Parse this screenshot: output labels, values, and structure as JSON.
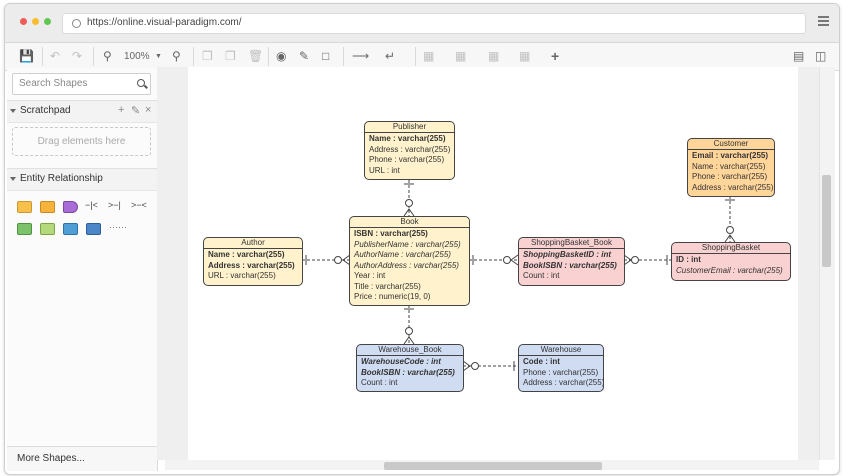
{
  "browser": {
    "url": "https://online.visual-paradigm.com/"
  },
  "toolbar": {
    "zoom": "100%"
  },
  "sidebar": {
    "search_placeholder": "Search Shapes",
    "scratchpad_title": "Scratchpad",
    "scratchpad_drag_text": "Drag elements here",
    "entity_section_title": "Entity Relationship",
    "more_shapes_label": "More Shapes..."
  },
  "diagram": {
    "publisher": {
      "title": "Publisher",
      "rows": [
        "Name : varchar(255)",
        "Address : varchar(255)",
        "Phone : varchar(255)",
        "URL : int"
      ]
    },
    "book": {
      "title": "Book",
      "rows": [
        "ISBN : varchar(255)",
        "PublisherName : varchar(255)",
        "AuthorName : varchar(255)",
        "AuthorAddress : varchar(255)",
        "Year : int",
        "Title : varchar(255)",
        "Price : numeric(19, 0)"
      ]
    },
    "author": {
      "title": "Author",
      "rows": [
        "Name : varchar(255)",
        "Address : varchar(255)",
        "URL : varchar(255)"
      ]
    },
    "customer": {
      "title": "Customer",
      "rows": [
        "Email : varchar(255)",
        "Name : varchar(255)",
        "Phone : varchar(255)",
        "Address : varchar(255)"
      ]
    },
    "shopping_basket_book": {
      "title": "ShoppingBasket_Book",
      "rows": [
        "ShoppingBasketID : int",
        "BookISBN : varchar(255)",
        "Count : int"
      ]
    },
    "shopping_basket": {
      "title": "ShoppingBasket",
      "rows": [
        "ID : int",
        "CustomerEmail : varchar(255)"
      ]
    },
    "warehouse_book": {
      "title": "Warehouse_Book",
      "rows": [
        "WarehouseCode : int",
        "BookISBN : varchar(255)",
        "Count : int"
      ]
    },
    "warehouse": {
      "title": "Warehouse",
      "rows": [
        "Code : int",
        "Phone : varchar(255)",
        "Address : varchar(255)"
      ]
    }
  },
  "colors": {
    "entity_yellow": "#fff2cc",
    "entity_orange": "#ffd59a",
    "entity_pink": "#f9d1d1",
    "entity_blue": "#cfdcf2"
  }
}
